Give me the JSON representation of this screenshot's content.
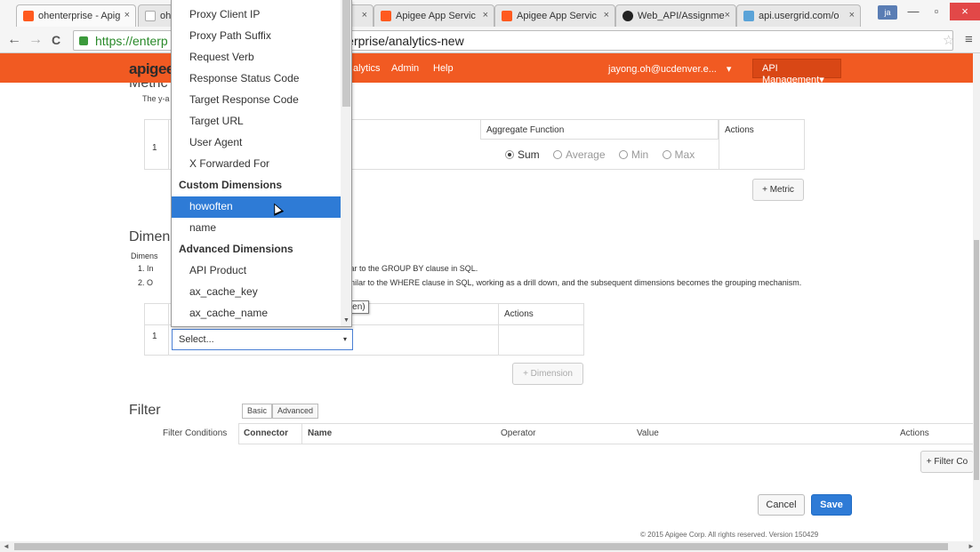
{
  "browser": {
    "tabs": [
      {
        "title": "ohenterprise - Apig",
        "icon": "apigee-icon"
      },
      {
        "title": "ohe",
        "icon": "doc-icon"
      },
      {
        "title": "",
        "icon": ""
      },
      {
        "title": "Apigee App Servic",
        "icon": "apigee-icon"
      },
      {
        "title": "Apigee App Servic",
        "icon": "apigee-icon"
      },
      {
        "title": "Web_API/Assignme",
        "icon": "github-icon"
      },
      {
        "title": "api.usergrid.com/o",
        "icon": "usergrid-icon"
      }
    ],
    "close_glyph": "×",
    "profile_initials": "ja",
    "url_scheme": "https://enterp",
    "url_rest": "enterprise/analytics-new",
    "back_glyph": "←",
    "forward_glyph": "→",
    "reload_glyph": "C",
    "star_glyph": "☆",
    "menu_glyph": "≡",
    "minimize_glyph": "—",
    "maximize_glyph": "▫",
    "window_close_glyph": "×"
  },
  "header": {
    "logo": "apigee",
    "nav": [
      "alytics",
      "Admin",
      "Help"
    ],
    "user": "jayong.oh@ucdenver.e...",
    "user_caret": "▾",
    "api_menu": "API Management",
    "api_caret": "▾"
  },
  "metrics": {
    "title_fragment": "Metric",
    "desc_fragment": "The y-a",
    "row_number": "1",
    "aggregate_header": "Aggregate Function",
    "actions_header": "Actions",
    "options": [
      {
        "label": "Sum",
        "selected": true
      },
      {
        "label": "Average",
        "selected": false
      },
      {
        "label": "Min",
        "selected": false
      },
      {
        "label": "Max",
        "selected": false
      }
    ],
    "add_button": "+ Metric"
  },
  "dimensions": {
    "title_fragment": "Dimen",
    "desc_fragment": "Dimens",
    "list_1_num": "1. In",
    "list_1_text": "milar to the GROUP BY clause in SQL.",
    "list_2_num": "2. O",
    "list_2_text": ", similar to the WHERE clause in SQL, working as a drill down, and the subsequent dimensions becomes the grouping mechanism.",
    "actions_header": "Actions",
    "row_number": "1",
    "select_value": "Select...",
    "select_caret": "▾",
    "add_button": "+ Dimension"
  },
  "dropdown": {
    "items": [
      {
        "label": "Proxy Client IP",
        "type": "option"
      },
      {
        "label": "Proxy Path Suffix",
        "type": "option"
      },
      {
        "label": "Request Verb",
        "type": "option"
      },
      {
        "label": "Response Status Code",
        "type": "option"
      },
      {
        "label": "Target Response Code",
        "type": "option"
      },
      {
        "label": "Target URL",
        "type": "option"
      },
      {
        "label": "User Agent",
        "type": "option"
      },
      {
        "label": "X Forwarded For",
        "type": "option"
      },
      {
        "label": "Custom Dimensions",
        "type": "group"
      },
      {
        "label": "howoften",
        "type": "option",
        "highlighted": true
      },
      {
        "label": "name",
        "type": "option"
      },
      {
        "label": "Advanced Dimensions",
        "type": "group"
      },
      {
        "label": "API Product",
        "type": "option"
      },
      {
        "label": "ax_cache_key",
        "type": "option"
      },
      {
        "label": "ax_cache_name",
        "type": "option"
      }
    ],
    "tooltip": "howoften (howoften)",
    "scroll_down_glyph": "▼"
  },
  "filter": {
    "title": "Filter",
    "modes": [
      "Basic",
      "Advanced"
    ],
    "conditions_label": "Filter Conditions",
    "columns": [
      "Connector",
      "Name",
      "Operator",
      "Value",
      "Actions"
    ],
    "add_button": "+ Filter Co"
  },
  "actions": {
    "cancel": "Cancel",
    "save": "Save"
  },
  "footer": "© 2015 Apigee Corp. All rights reserved. Version 150429",
  "scroll_left_glyph": "◄",
  "scroll_right_glyph": "►",
  "colors": {
    "brand": "#f15a22",
    "highlight": "#2e7bd6"
  }
}
